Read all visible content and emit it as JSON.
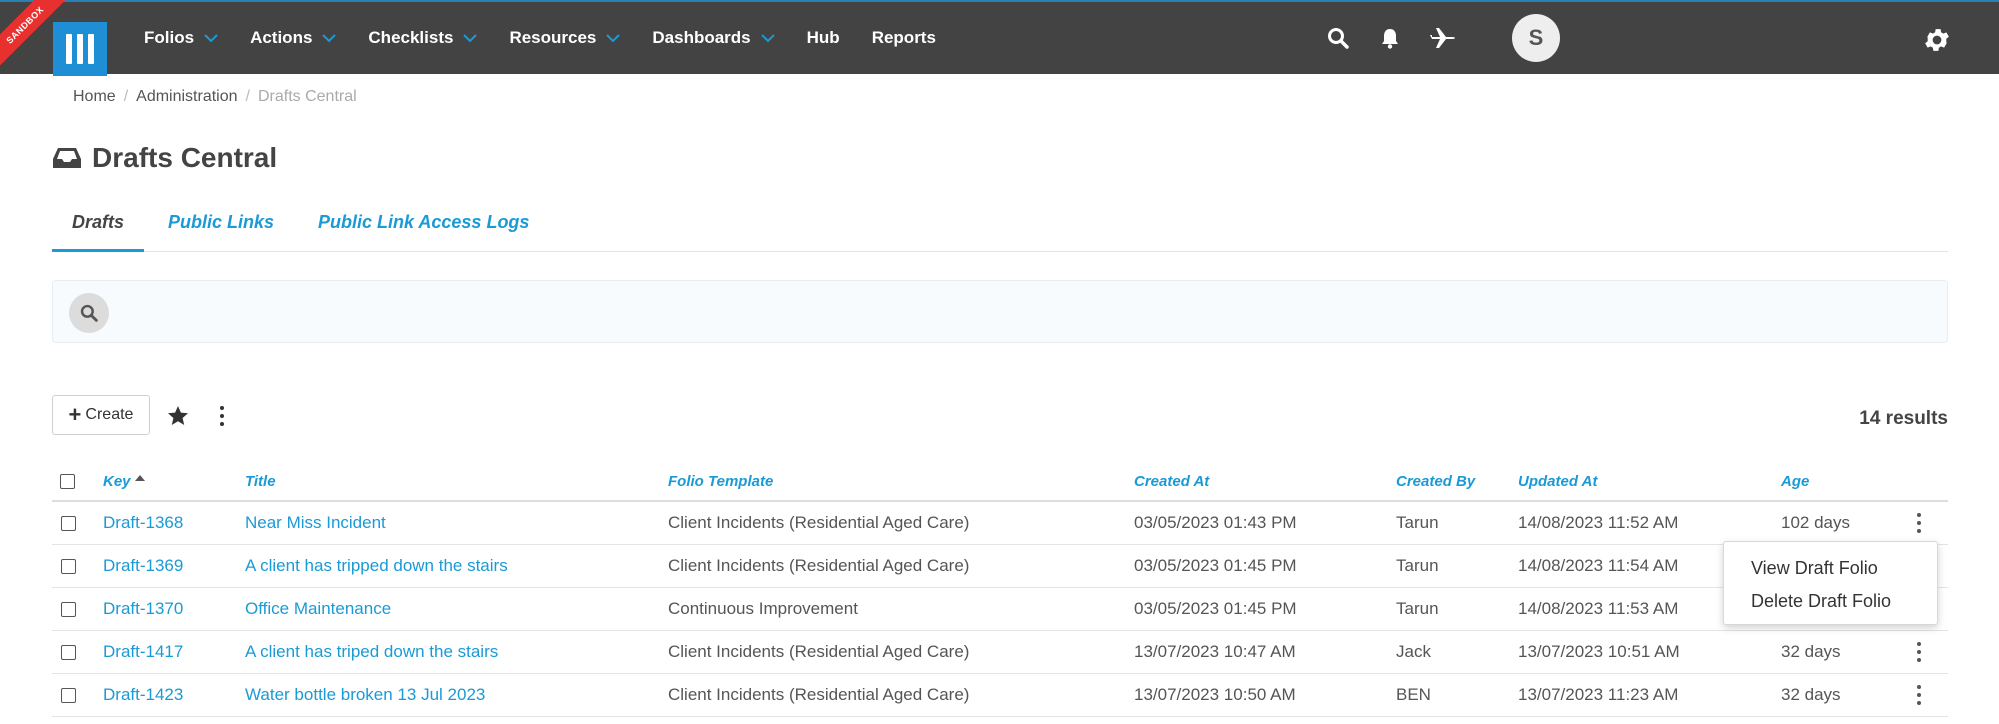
{
  "nav": {
    "badge": "SANDBOX",
    "items": [
      {
        "label": "Folios",
        "dropdown": true
      },
      {
        "label": "Actions",
        "dropdown": true
      },
      {
        "label": "Checklists",
        "dropdown": true
      },
      {
        "label": "Resources",
        "dropdown": true
      },
      {
        "label": "Dashboards",
        "dropdown": true
      },
      {
        "label": "Hub",
        "dropdown": false
      },
      {
        "label": "Reports",
        "dropdown": false
      }
    ],
    "avatar_initial": "S",
    "icons": [
      "search-icon",
      "bell-icon",
      "plane-icon",
      "gear-icon"
    ]
  },
  "breadcrumb": {
    "items": [
      "Home",
      "Administration"
    ],
    "current": "Drafts Central"
  },
  "page": {
    "title": "Drafts Central",
    "title_icon": "inbox-icon"
  },
  "tabs": [
    {
      "label": "Drafts",
      "active": true
    },
    {
      "label": "Public Links",
      "active": false
    },
    {
      "label": "Public Link Access Logs",
      "active": false
    }
  ],
  "toolbar": {
    "create_label": "Create",
    "results": "14 results"
  },
  "table": {
    "columns": [
      "Key",
      "Title",
      "Folio Template",
      "Created At",
      "Created By",
      "Updated At",
      "Age"
    ],
    "rows": [
      {
        "key": "Draft-1368",
        "title": "Near Miss Incident",
        "template": "Client Incidents (Residential Aged Care)",
        "created_at": "03/05/2023 01:43 PM",
        "created_by": "Tarun",
        "updated_at": "14/08/2023 11:52 AM",
        "age": "102 days"
      },
      {
        "key": "Draft-1369",
        "title": "A client has tripped down the stairs",
        "template": "Client Incidents (Residential Aged Care)",
        "created_at": "03/05/2023 01:45 PM",
        "created_by": "Tarun",
        "updated_at": "14/08/2023 11:54 AM",
        "age": ""
      },
      {
        "key": "Draft-1370",
        "title": "Office Maintenance",
        "template": "Continuous Improvement",
        "created_at": "03/05/2023 01:45 PM",
        "created_by": "Tarun",
        "updated_at": "14/08/2023 11:53 AM",
        "age": ""
      },
      {
        "key": "Draft-1417",
        "title": "A client has triped down the stairs",
        "template": "Client Incidents (Residential Aged Care)",
        "created_at": "13/07/2023 10:47 AM",
        "created_by": "Jack",
        "updated_at": "13/07/2023 10:51 AM",
        "age": "32 days"
      },
      {
        "key": "Draft-1423",
        "title": "Water bottle broken 13 Jul 2023",
        "template": "Client Incidents (Residential Aged Care)",
        "created_at": "13/07/2023 10:50 AM",
        "created_by": "BEN",
        "updated_at": "13/07/2023 11:23 AM",
        "age": "32 days"
      }
    ]
  },
  "context_menu": {
    "items": [
      "View Draft Folio",
      "Delete Draft Folio"
    ]
  },
  "colors": {
    "navbar": "#434343",
    "accent": "#1a9ad6",
    "logo": "#1e8fd5",
    "badge": "#e8312f"
  }
}
